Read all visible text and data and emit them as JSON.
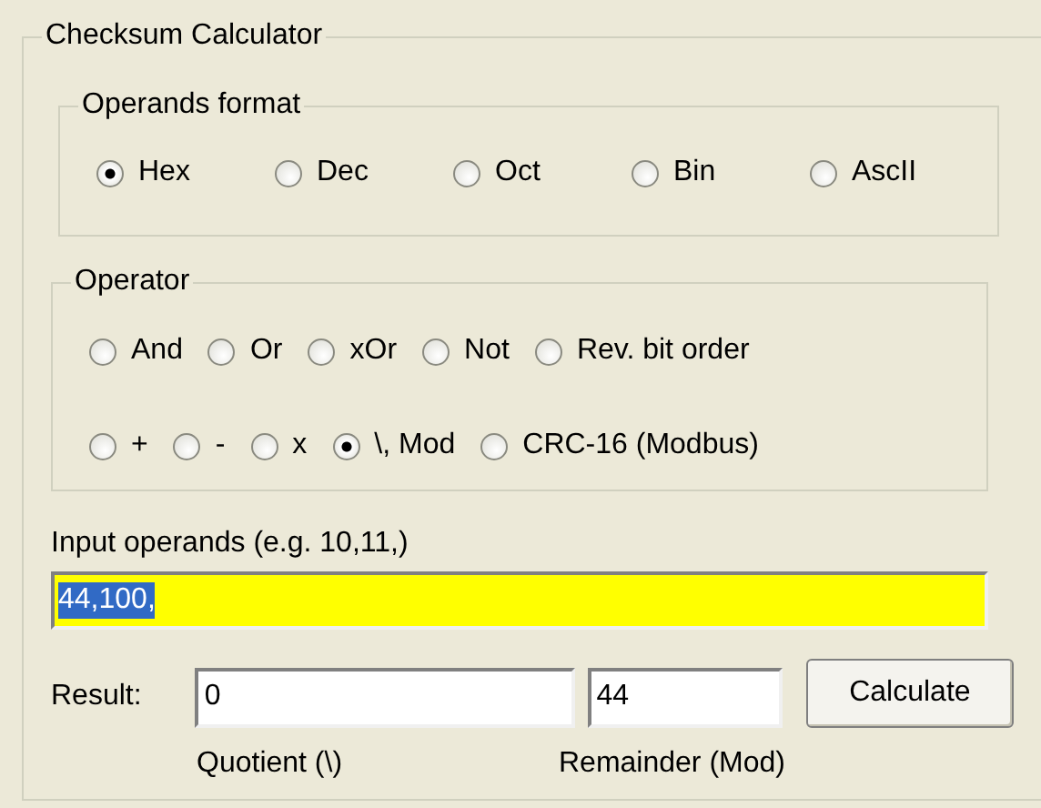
{
  "group": {
    "title": "Checksum Calculator"
  },
  "operands_format": {
    "title": "Operands format",
    "options": [
      {
        "label": "Hex",
        "selected": true
      },
      {
        "label": "Dec",
        "selected": false
      },
      {
        "label": "Oct",
        "selected": false
      },
      {
        "label": "Bin",
        "selected": false
      },
      {
        "label": "AscII",
        "selected": false
      }
    ]
  },
  "operator": {
    "title": "Operator",
    "rows": [
      [
        {
          "label": "And",
          "selected": false
        },
        {
          "label": "Or",
          "selected": false
        },
        {
          "label": "xOr",
          "selected": false
        },
        {
          "label": "Not",
          "selected": false
        },
        {
          "label": "Rev. bit order",
          "selected": false
        }
      ],
      [
        {
          "label": "+",
          "selected": false
        },
        {
          "label": "-",
          "selected": false
        },
        {
          "label": "x",
          "selected": false
        },
        {
          "label": "\\, Mod",
          "selected": true
        },
        {
          "label": "CRC-16 (Modbus)",
          "selected": false
        }
      ]
    ]
  },
  "input": {
    "label": "Input operands (e.g. 10,11,)",
    "value": "44,100,",
    "text_selected": true
  },
  "result": {
    "label": "Result:",
    "quotient": "0",
    "remainder": "44",
    "button": "Calculate",
    "quotient_caption": "Quotient (\\)",
    "remainder_caption": "Remainder (Mod)"
  }
}
